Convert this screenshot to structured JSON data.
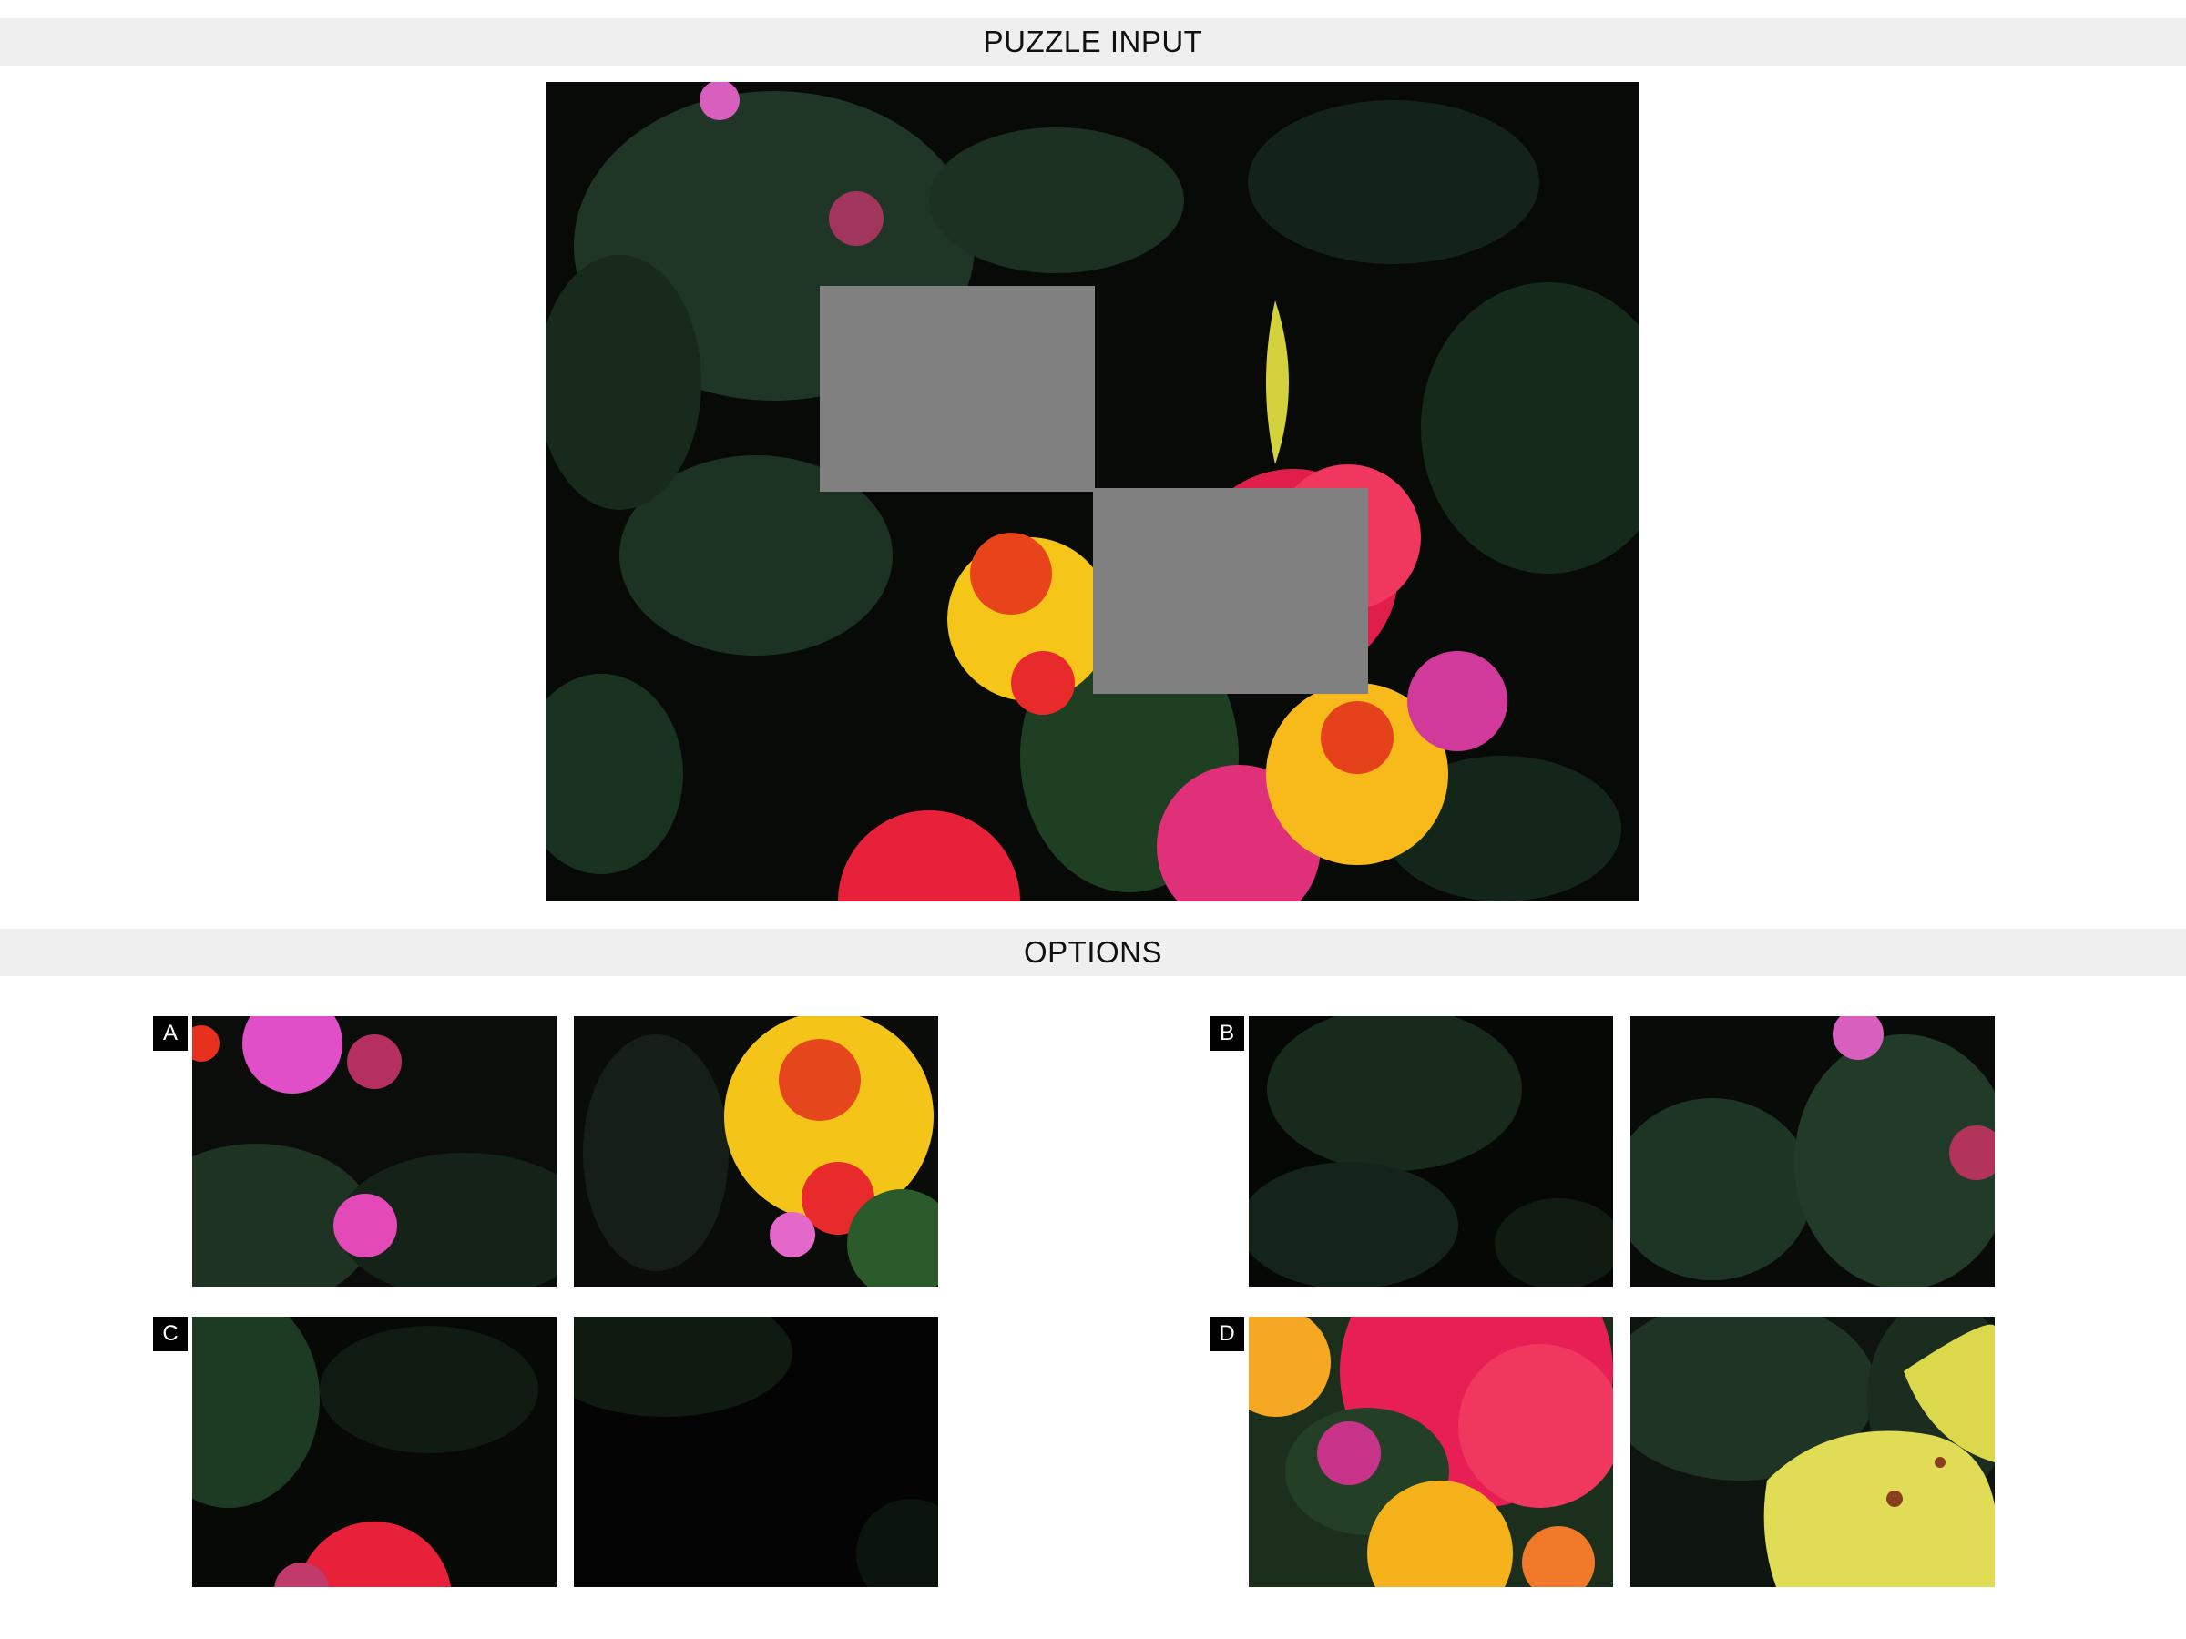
{
  "headers": {
    "puzzle": "PUZZLE INPUT",
    "options": "OPTIONS"
  },
  "options": [
    {
      "label": "A",
      "tiles": [
        "pink-lantana-dark-leaf",
        "yellow-lantana-cluster"
      ]
    },
    {
      "label": "B",
      "tiles": [
        "dark-green-foliage",
        "leaf-pink-bud"
      ]
    },
    {
      "label": "C",
      "tiles": [
        "dark-foliage-red-flower-edge",
        "dark-background"
      ]
    },
    {
      "label": "D",
      "tiles": [
        "pink-yellow-lantana-cluster",
        "yellow-butterfly-wing"
      ]
    }
  ],
  "colors": {
    "header_bg": "#efefef",
    "hole_gray": "#808080",
    "label_bg": "#000000"
  }
}
